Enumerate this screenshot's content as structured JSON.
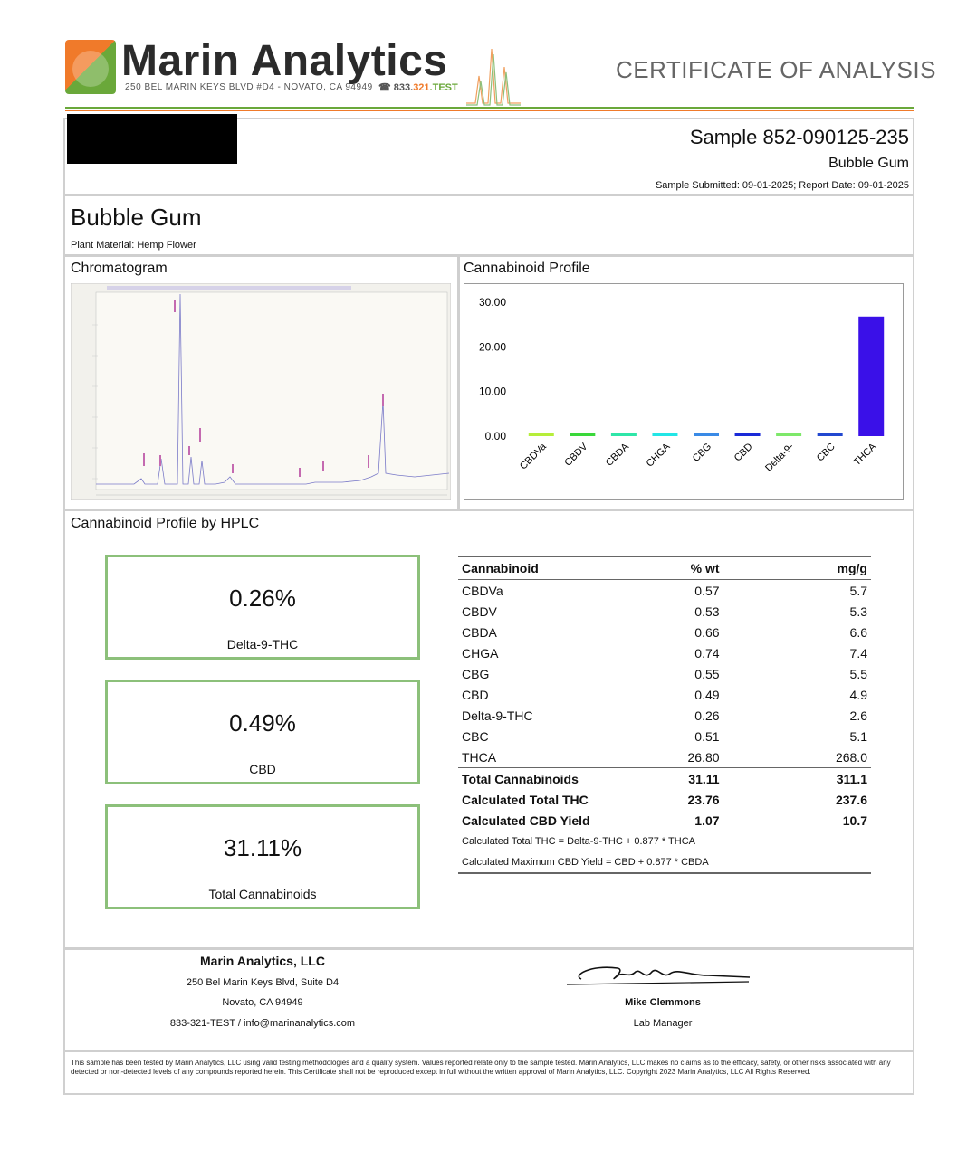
{
  "header": {
    "brand": "Marin Analytics",
    "address": "250 BEL MARIN KEYS BLVD #D4 - NOVATO, CA 94949",
    "phone_prefix": "833.",
    "phone_mid": "321",
    "phone_suffix": ".TEST",
    "doc_type": "CERTIFICATE OF ANALYSIS"
  },
  "sample": {
    "id": "Sample 852-090125-235",
    "name": "Bubble Gum",
    "dates": "Sample Submitted: 09-01-2025;  Report Date: 09-01-2025"
  },
  "product": {
    "title": "Bubble Gum",
    "plant_material": "Plant Material: Hemp Flower"
  },
  "sections": {
    "chromatogram": "Chromatogram",
    "profile": "Cannabinoid Profile",
    "hplc": "Cannabinoid Profile by HPLC"
  },
  "chart_data": {
    "type": "bar",
    "categories": [
      "CBDVa",
      "CBDV",
      "CBDA",
      "CHGA",
      "CBG",
      "CBD",
      "Delta-9-",
      "CBC",
      "THCA"
    ],
    "values": [
      0.57,
      0.53,
      0.66,
      0.74,
      0.55,
      0.49,
      0.26,
      0.51,
      26.8
    ],
    "colors": [
      "#b6ee3a",
      "#3ad83a",
      "#2ee6a8",
      "#22e6e6",
      "#3a8ae6",
      "#1a2ad8",
      "#7ee86a",
      "#2248d0",
      "#3a10e8"
    ],
    "ylim": [
      0,
      30
    ],
    "yticks": [
      "30.00",
      "20.00",
      "10.00",
      "0.00"
    ],
    "title": "",
    "xlabel": "",
    "ylabel": ""
  },
  "summary": [
    {
      "value": "0.26%",
      "label": "Delta-9-THC"
    },
    {
      "value": "0.49%",
      "label": "CBD"
    },
    {
      "value": "31.11%",
      "label": "Total Cannabinoids"
    }
  ],
  "table": {
    "headers": [
      "Cannabinoid",
      "% wt",
      "mg/g"
    ],
    "rows": [
      [
        "CBDVa",
        "0.57",
        "5.7"
      ],
      [
        "CBDV",
        "0.53",
        "5.3"
      ],
      [
        "CBDA",
        "0.66",
        "6.6"
      ],
      [
        "CHGA",
        "0.74",
        "7.4"
      ],
      [
        "CBG",
        "0.55",
        "5.5"
      ],
      [
        "CBD",
        "0.49",
        "4.9"
      ],
      [
        "Delta-9-THC",
        "0.26",
        "2.6"
      ],
      [
        "CBC",
        "0.51",
        "5.1"
      ],
      [
        "THCA",
        "26.80",
        "268.0"
      ]
    ],
    "totals": [
      [
        "Total Cannabinoids",
        "31.11",
        "311.1"
      ],
      [
        "Calculated Total THC",
        "23.76",
        "237.6"
      ],
      [
        "Calculated CBD Yield",
        "1.07",
        "10.7"
      ]
    ],
    "notes": [
      "Calculated Total THC = Delta-9-THC + 0.877 * THCA",
      "Calculated Maximum CBD Yield = CBD + 0.877 * CBDA"
    ]
  },
  "footer": {
    "company": "Marin Analytics, LLC",
    "street": "250 Bel Marin Keys Blvd, Suite D4",
    "city": "Novato, CA 94949",
    "contact": "833-321-TEST / info@marinanalytics.com",
    "signer": "Mike Clemmons",
    "signer_title": "Lab Manager",
    "disclaimer": "This sample has been tested by Marin Analytics, LLC using valid testing methodologies and a quality system.  Values reported relate only to the sample tested.  Marin Analytics, LLC makes no claims as to the efficacy, safety, or other risks associated with any detected or non-detected levels of any compounds reported herein.  This Certificate shall not be reproduced except in full without the written approval of Marin Analytics, LLC. Copyright 2023 Marin Analytics, LLC All Rights Reserved."
  }
}
